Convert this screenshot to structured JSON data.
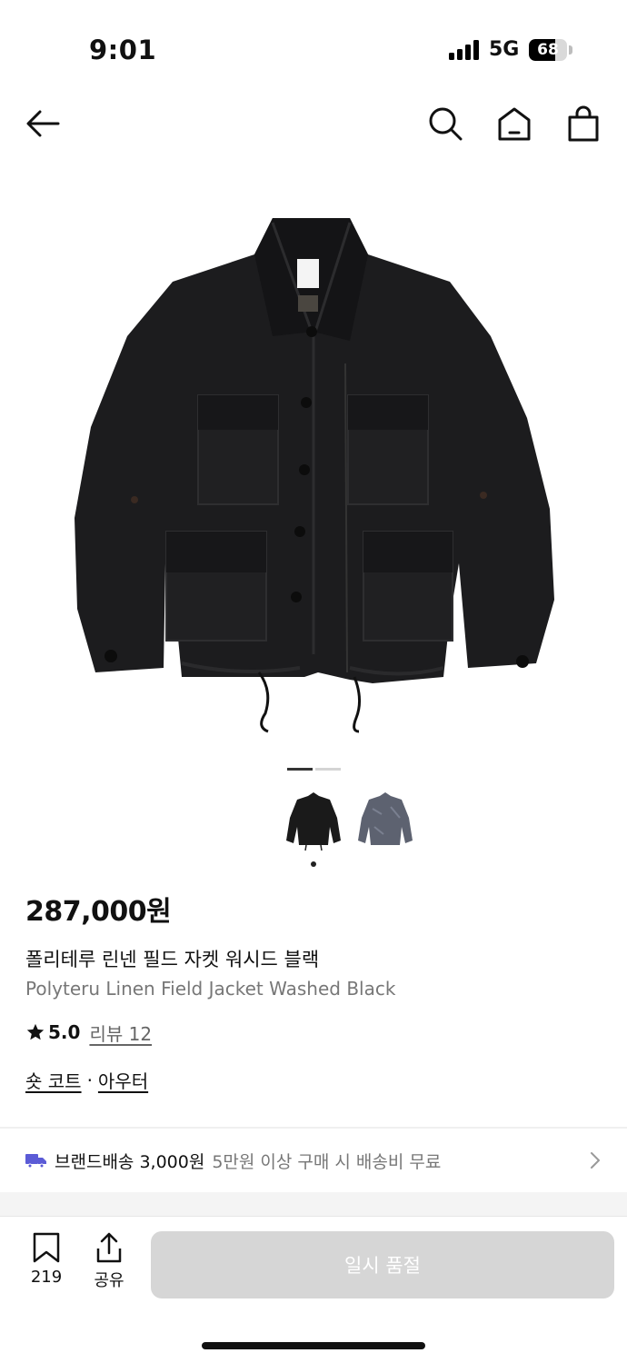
{
  "status_bar": {
    "time": "9:01",
    "network": "5G",
    "battery": "68",
    "battery_fraction": 0.68
  },
  "nav": {
    "icons": [
      "back-arrow-icon",
      "search-icon",
      "home-icon",
      "shopping-bag-icon"
    ]
  },
  "gallery": {
    "image_count": 2,
    "active_index": 0
  },
  "product": {
    "price": "287,000원",
    "name_ko": "폴리테루 린넨 필드 자켓 워시드 블랙",
    "name_en": "Polyteru Linen Field Jacket Washed Black",
    "rating": "5.0",
    "review_label": "리뷰 12",
    "category_1": "숏 코트",
    "category_separator": "·",
    "category_2": "아우터"
  },
  "shipping": {
    "brand_label": "브랜드배송 3,000원",
    "description": "5만원 이상 구매 시 배송비 무료",
    "icon_color": "#5b5bd6"
  },
  "bottom_bar": {
    "bookmark_count": "219",
    "share_label": "공유",
    "soldout_label": "일시 품절"
  }
}
